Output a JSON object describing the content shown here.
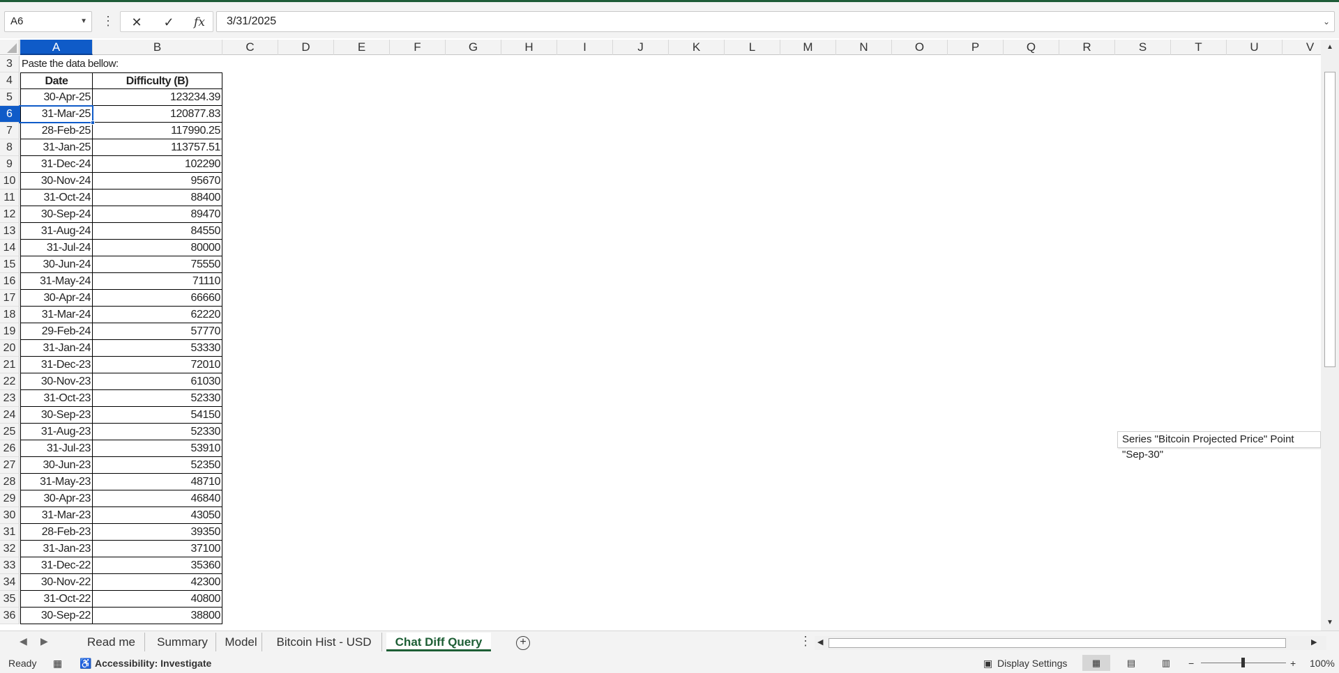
{
  "formula_bar": {
    "name_box": "A6",
    "cancel_icon": "✕",
    "enter_icon": "✓",
    "fx_label": "fx",
    "formula": "3/31/2025"
  },
  "columns": [
    "A",
    "B",
    "C",
    "D",
    "E",
    "F",
    "G",
    "H",
    "I",
    "J",
    "K",
    "L",
    "M",
    "N",
    "O",
    "P",
    "Q",
    "R",
    "S",
    "T",
    "U",
    "V"
  ],
  "selected_cell": "A6",
  "note_text": "Paste the data bellow:",
  "table": {
    "headers": [
      "Date",
      "Difficulty (B)"
    ],
    "rows": [
      [
        "30-Apr-25",
        "123234.39"
      ],
      [
        "31-Mar-25",
        "120877.83"
      ],
      [
        "28-Feb-25",
        "117990.25"
      ],
      [
        "31-Jan-25",
        "113757.51"
      ],
      [
        "31-Dec-24",
        "102290"
      ],
      [
        "30-Nov-24",
        "95670"
      ],
      [
        "31-Oct-24",
        "88400"
      ],
      [
        "30-Sep-24",
        "89470"
      ],
      [
        "31-Aug-24",
        "84550"
      ],
      [
        "31-Jul-24",
        "80000"
      ],
      [
        "30-Jun-24",
        "75550"
      ],
      [
        "31-May-24",
        "71110"
      ],
      [
        "30-Apr-24",
        "66660"
      ],
      [
        "31-Mar-24",
        "62220"
      ],
      [
        "29-Feb-24",
        "57770"
      ],
      [
        "31-Jan-24",
        "53330"
      ],
      [
        "31-Dec-23",
        "72010"
      ],
      [
        "30-Nov-23",
        "61030"
      ],
      [
        "31-Oct-23",
        "52330"
      ],
      [
        "30-Sep-23",
        "54150"
      ],
      [
        "31-Aug-23",
        "52330"
      ],
      [
        "31-Jul-23",
        "53910"
      ],
      [
        "30-Jun-23",
        "52350"
      ],
      [
        "31-May-23",
        "48710"
      ],
      [
        "30-Apr-23",
        "46840"
      ],
      [
        "31-Mar-23",
        "43050"
      ],
      [
        "28-Feb-23",
        "39350"
      ],
      [
        "31-Jan-23",
        "37100"
      ],
      [
        "31-Dec-22",
        "35360"
      ],
      [
        "30-Nov-22",
        "42300"
      ],
      [
        "31-Oct-22",
        "40800"
      ],
      [
        "30-Sep-22",
        "38800"
      ]
    ]
  },
  "row_numbers": [
    "3",
    "4",
    "5",
    "6",
    "7",
    "8",
    "9",
    "10",
    "11",
    "12",
    "13",
    "14",
    "15",
    "16",
    "17",
    "18",
    "19",
    "20",
    "21",
    "22",
    "23",
    "24",
    "25",
    "26",
    "27",
    "28",
    "29",
    "30",
    "31",
    "32",
    "33",
    "34",
    "35",
    "36"
  ],
  "tooltip": "Series \"Bitcoin Projected Price\" Point \"Sep-30\"",
  "sheet_tabs": [
    "Read me",
    "Summary",
    "Model",
    "Bitcoin Hist - USD",
    "Chat Diff Query"
  ],
  "active_tab": "Chat Diff Query",
  "status": {
    "ready": "Ready",
    "accessibility": "Accessibility: Investigate",
    "display_settings": "Display Settings",
    "zoom": "100%"
  },
  "colors": {
    "accent_green": "#1d5e35",
    "selection_blue": "#0f5bc8"
  }
}
